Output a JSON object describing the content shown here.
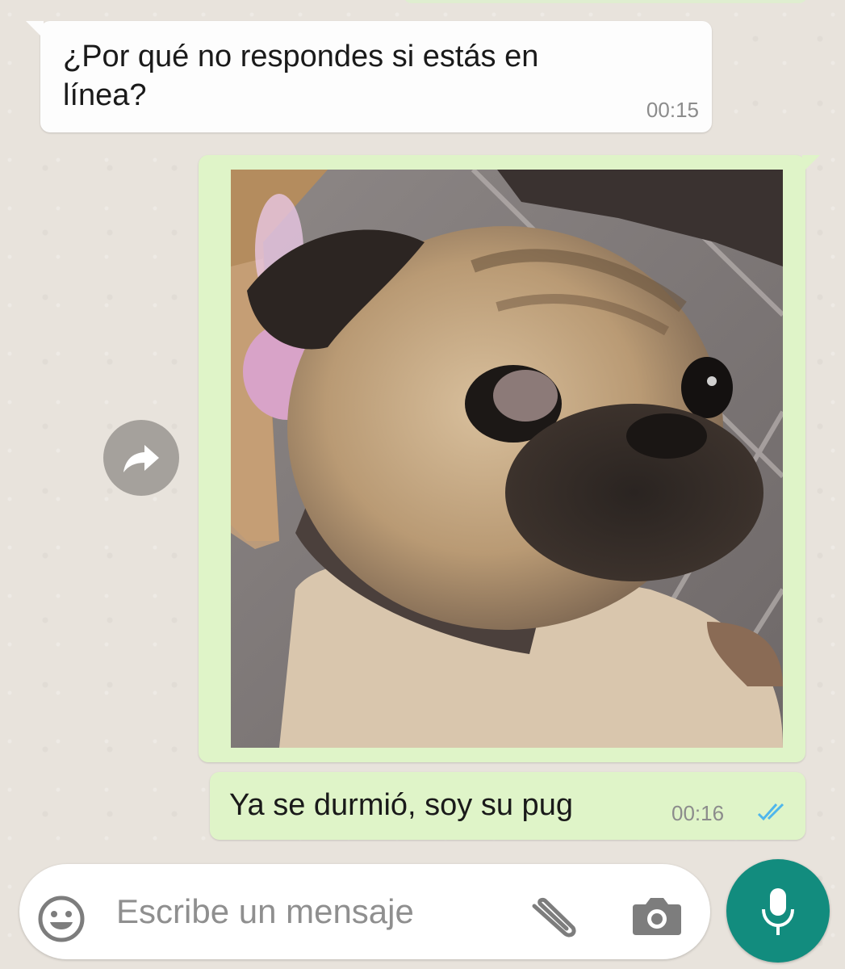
{
  "conversation": {
    "incoming_message": {
      "text": "¿Por qué no respondes si estás en línea?",
      "time": "00:15"
    },
    "outgoing_image": {
      "description": "photo-of-pug"
    },
    "outgoing_message": {
      "text": "Ya se durmió, soy su pug",
      "time": "00:16",
      "status": "read"
    }
  },
  "composer": {
    "placeholder": "Escribe un mensaje"
  },
  "colors": {
    "outgoing_bubble": "#dff4c8",
    "incoming_bubble": "#fdfdfd",
    "chat_background": "#e8e3dc",
    "accent": "#128c7e",
    "read_ticks": "#4fb6ec"
  },
  "icons": [
    "forward-icon",
    "read-ticks-icon",
    "emoji-icon",
    "attach-icon",
    "camera-icon",
    "mic-icon"
  ]
}
